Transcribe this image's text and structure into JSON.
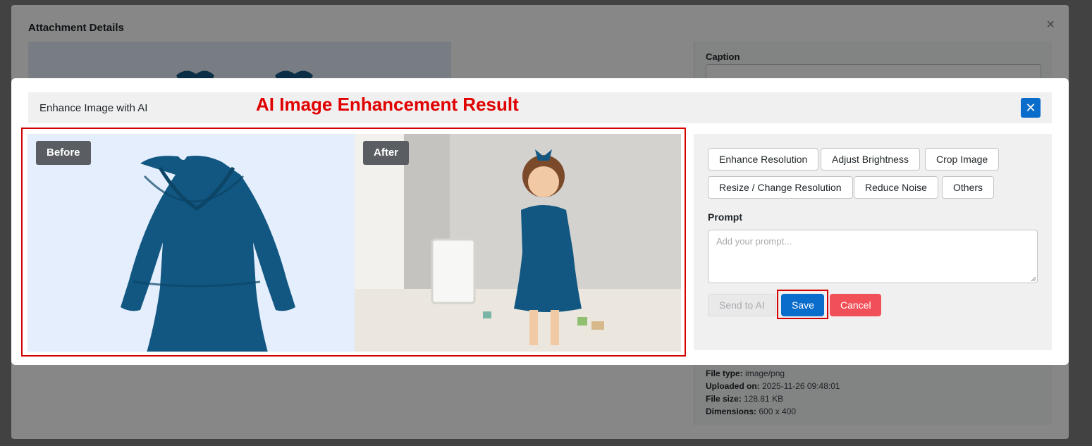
{
  "background_modal": {
    "title": "Attachment Details",
    "close_glyph": "×",
    "caption_label": "Caption",
    "meta": {
      "file_type_label": "File type:",
      "file_type": "image/png",
      "uploaded_label": "Uploaded on:",
      "uploaded": "2025-11-26 09:48:01",
      "size_label": "File size:",
      "size": "128.81 KB",
      "dimensions_label": "Dimensions:",
      "dimensions": "600 x 400"
    }
  },
  "ai_modal": {
    "title": "Enhance Image with AI",
    "close_glyph": "✕",
    "annotation": "AI Image Enhancement Result",
    "before_label": "Before",
    "after_label": "After",
    "options": [
      "Enhance Resolution",
      "Adjust Brightness",
      "Crop Image",
      "Resize / Change Resolution",
      "Reduce Noise",
      "Others"
    ],
    "prompt_label": "Prompt",
    "prompt_placeholder": "Add your prompt...",
    "prompt_value": "",
    "send_label": "Send to AI",
    "save_label": "Save",
    "cancel_label": "Cancel"
  },
  "colors": {
    "primary": "#0a6ccb",
    "danger": "#f25058",
    "annotation_red": "#e00000",
    "dress_blue": "#125782"
  }
}
